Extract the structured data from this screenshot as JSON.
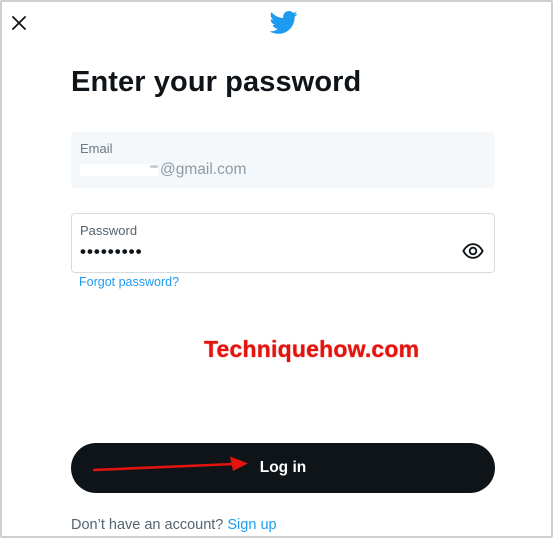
{
  "modal": {
    "title": "Enter your password"
  },
  "email": {
    "label": "Email",
    "value_suffix": "@gmail.com"
  },
  "password": {
    "label": "Password",
    "masked_value": "•••••••••"
  },
  "links": {
    "forgot": "Forgot password?"
  },
  "watermark": "Techniquehow.com",
  "login": {
    "label": "Log in"
  },
  "signup": {
    "prompt": "Don’t have an account?",
    "link": "Sign up"
  },
  "icons": {
    "close": "close-icon",
    "logo": "twitter-bird-icon",
    "eye": "eye-icon"
  },
  "colors": {
    "brand": "#1d9bf0",
    "button_bg": "#0f1419",
    "watermark": "#e3130e"
  }
}
